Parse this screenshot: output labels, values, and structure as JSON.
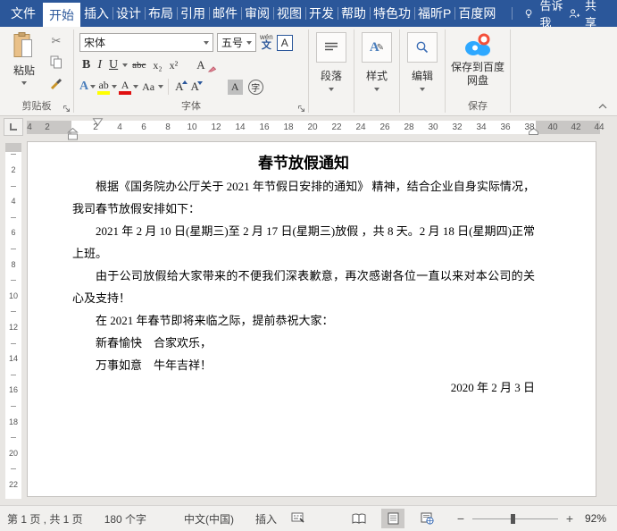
{
  "colors": {
    "accent": "#2b579a",
    "ribbon_bg": "#f4f3f1",
    "highlight_yellow": "#ffff00",
    "font_color_red": "#e01010",
    "baidu_blue": "#2ea8ff",
    "baidu_red": "#f4503a"
  },
  "tabbar": {
    "tabs": [
      {
        "label": "文件",
        "active": false
      },
      {
        "label": "开始",
        "active": true
      },
      {
        "label": "插入",
        "active": false
      },
      {
        "label": "设计",
        "active": false
      },
      {
        "label": "布局",
        "active": false
      },
      {
        "label": "引用",
        "active": false
      },
      {
        "label": "邮件",
        "active": false
      },
      {
        "label": "审阅",
        "active": false
      },
      {
        "label": "视图",
        "active": false
      },
      {
        "label": "开发",
        "active": false
      },
      {
        "label": "帮助",
        "active": false
      },
      {
        "label": "特色功",
        "active": false
      },
      {
        "label": "福昕P",
        "active": false
      },
      {
        "label": "百度网",
        "active": false
      }
    ],
    "tell_me": "告诉我",
    "share": "共享"
  },
  "ribbon": {
    "clipboard": {
      "paste_label": "粘贴",
      "group_label": "剪贴板"
    },
    "font": {
      "font_name": "宋体",
      "font_size": "五号",
      "pinyin_top": "wén",
      "pinyin_char": "文",
      "char_border": "A",
      "bold": "B",
      "italic": "I",
      "underline": "U",
      "strikethrough": "abc",
      "subscript": "x₂",
      "superscript": "x²",
      "clear_format": "A",
      "text_effects": "A",
      "highlight": "ab",
      "font_color": "A",
      "change_case": "Aa",
      "grow_font": "A",
      "shrink_font": "A",
      "char_shading": "A",
      "enclose_char": "字",
      "group_label": "字体"
    },
    "paragraph": {
      "label": "段落"
    },
    "styles": {
      "label": "样式"
    },
    "editing": {
      "label": "编辑"
    },
    "save": {
      "button_label": "保存到百度网盘",
      "group_label": "保存"
    }
  },
  "ruler": {
    "h_left": [
      "4",
      "2"
    ],
    "h_white": [
      "2",
      "4",
      "6",
      "8",
      "10",
      "12",
      "14",
      "16",
      "18",
      "20",
      "22",
      "24",
      "26",
      "28",
      "30",
      "32",
      "34",
      "36",
      "38"
    ],
    "h_right": [
      "40",
      "42",
      "44"
    ],
    "v": [
      "2",
      "4",
      "6",
      "8",
      "10",
      "12",
      "14",
      "16",
      "18",
      "20",
      "22"
    ]
  },
  "document": {
    "title": "春节放假通知",
    "paragraphs": [
      {
        "text": "根据《国务院办公厅关于 2021 年节假日安排的通知》 精神，结合企业自身实际情况，我司春节放假安排如下：",
        "align": "justify"
      },
      {
        "text": "2021 年 2 月 10 日(星期三)至 2 月 17 日(星期三)放假 ，共 8 天。2 月 18 日(星期四)正常上班。",
        "align": "justify"
      },
      {
        "text": "由于公司放假给大家带来的不便我们深表歉意，再次感谢各位一直以来对本公司的关心及支持！",
        "align": "justify"
      },
      {
        "text": "在 2021 年春节即将来临之际，提前恭祝大家：",
        "align": "left"
      },
      {
        "text": "新春愉快　合家欢乐，",
        "align": "left"
      },
      {
        "text": "万事如意　牛年吉祥！",
        "align": "left"
      },
      {
        "text": "2020 年 2 月 3 日",
        "align": "right"
      }
    ]
  },
  "statusbar": {
    "page_info": "第 1 页 , 共 1 页",
    "word_count": "180 个字",
    "language": "中文(中国)",
    "insert_mode": "插入",
    "zoom_level": "92%"
  }
}
